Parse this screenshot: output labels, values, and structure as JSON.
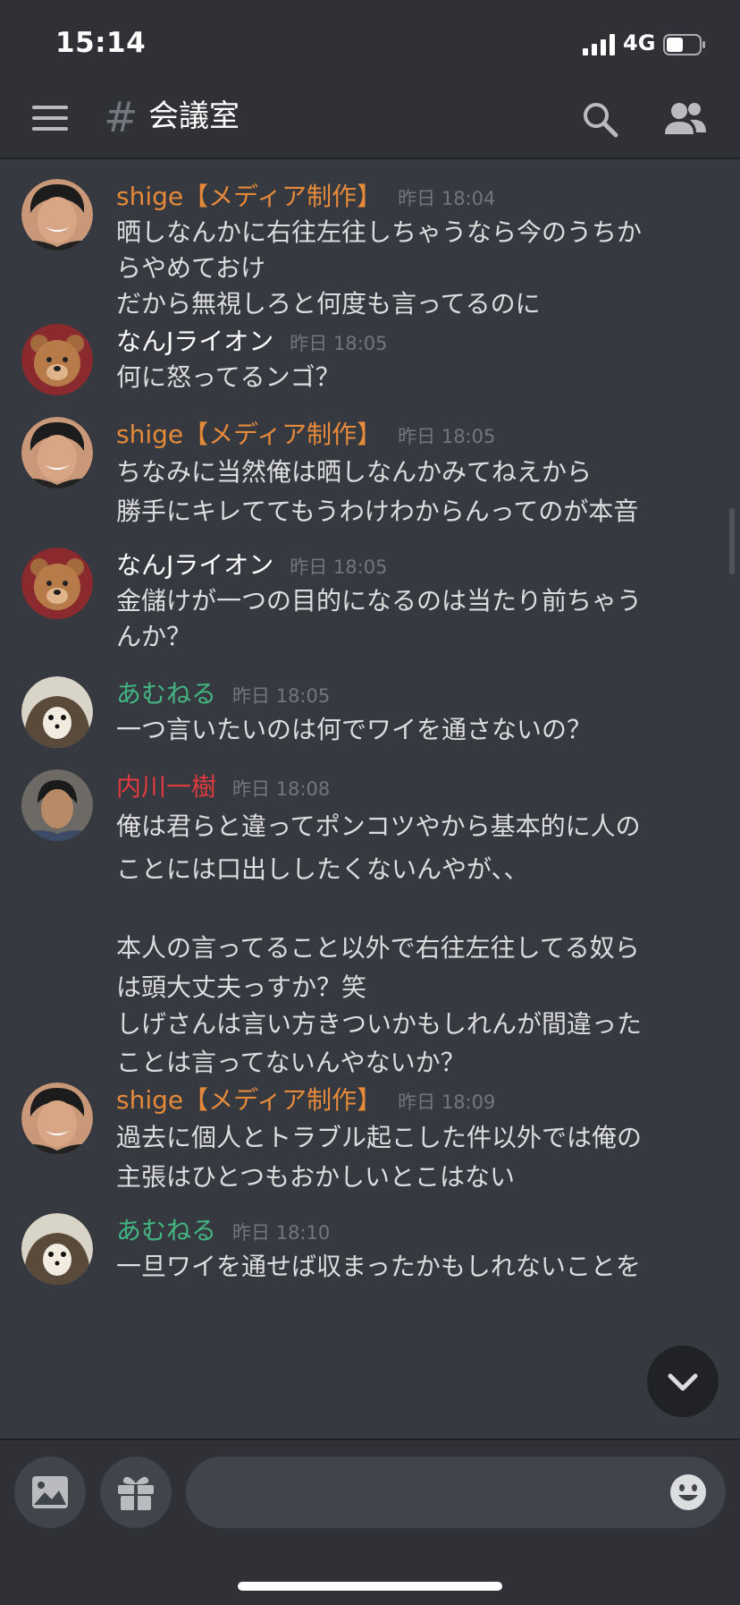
{
  "status_bar": {
    "time": "15:14",
    "network": "4G"
  },
  "header": {
    "channel_name": "会議室"
  },
  "colors": {
    "shige": "#e58a3a",
    "nanj": "#ffffff",
    "amuneru": "#43b581",
    "uchikawa": "#e03a3e"
  },
  "messages": [
    {
      "author": "shige【メディア制作】",
      "time": "昨日 18:04",
      "avatar": "man-avatar",
      "lines": [
        "晒しなんかに右往左往しちゃうなら今のうちか",
        "らやめておけ",
        "だから無視しろと何度も言ってるのに"
      ]
    },
    {
      "author": "なんJライオン",
      "time": "昨日 18:05",
      "avatar": "bear-avatar",
      "lines": [
        "何に怒ってるンゴ？"
      ]
    },
    {
      "author": "shige【メディア制作】",
      "time": "昨日 18:05",
      "avatar": "man-avatar",
      "lines": [
        "ちなみに当然俺は晒しなんかみてねえから",
        "勝手にキレててもうわけわからんってのが本音"
      ]
    },
    {
      "author": "なんJライオン",
      "time": "昨日 18:05",
      "avatar": "bear-avatar",
      "lines": [
        "金儲けが一つの目的になるのは当たり前ちゃう",
        "んか？"
      ]
    },
    {
      "author": "あむねる",
      "time": "昨日 18:05",
      "avatar": "hedgehog-avatar",
      "lines": [
        "一つ言いたいのは何でワイを通さないの？"
      ]
    },
    {
      "author": "内川一樹",
      "time": "昨日 18:08",
      "avatar": "person-avatar",
      "lines": [
        "俺は君らと違ってポンコツやから基本的に人の",
        "ことには口出ししたくないんやが、、",
        "",
        "本人の言ってること以外で右往左往してる奴ら",
        "は頭大丈夫っすか？笑",
        "しげさんは言い方きついかもしれんが間違った",
        "ことは言ってないんやないか？"
      ]
    },
    {
      "author": "shige【メディア制作】",
      "time": "昨日 18:09",
      "avatar": "man-avatar",
      "lines": [
        "過去に個人とトラブル起こした件以外では俺の",
        "主張はひとつもおかしいとこはない"
      ]
    },
    {
      "author": "あむねる",
      "time": "昨日 18:10",
      "avatar": "hedgehog-avatar",
      "lines": [
        "一旦ワイを通せば収まったかもしれないことを"
      ]
    }
  ],
  "composer": {
    "placeholder": ""
  }
}
